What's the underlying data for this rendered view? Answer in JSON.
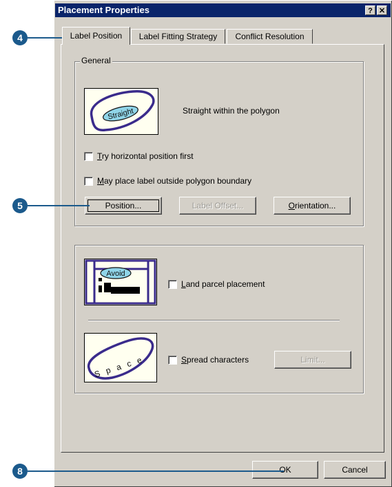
{
  "window": {
    "title": "Placement Properties",
    "help_btn": "?",
    "close_btn": "✕"
  },
  "tabs": [
    {
      "label": "Label Position",
      "active": true
    },
    {
      "label": "Label Fitting Strategy",
      "active": false
    },
    {
      "label": "Conflict Resolution",
      "active": false
    }
  ],
  "general": {
    "legend": "General",
    "icon_text": "Straight",
    "description": "Straight within the polygon",
    "try_horizontal": {
      "label_accel": "T",
      "label_rest": "ry horizontal position first",
      "checked": false
    },
    "outside_boundary": {
      "label_accel": "M",
      "label_rest": "ay place label outside polygon boundary",
      "checked": false
    },
    "buttons": {
      "position": "Position...",
      "label_offset": "Label Offset...",
      "orientation_accel": "O",
      "orientation_rest": "rientation..."
    }
  },
  "options": {
    "land_parcel": {
      "icon_text": "Avoid",
      "label_accel": "L",
      "label_rest": "and parcel placement",
      "checked": false
    },
    "spread": {
      "icon_text": "S p a c e",
      "label_accel": "S",
      "label_rest": "pread characters",
      "checked": false,
      "limit_button": "Limit..."
    }
  },
  "footer": {
    "ok": "OK",
    "cancel": "Cancel"
  },
  "callouts": [
    "4",
    "5",
    "8"
  ],
  "colors": {
    "titlebar": "#0a246a",
    "callout": "#1b5a8c",
    "dialog_bg": "#d4d0c8"
  }
}
